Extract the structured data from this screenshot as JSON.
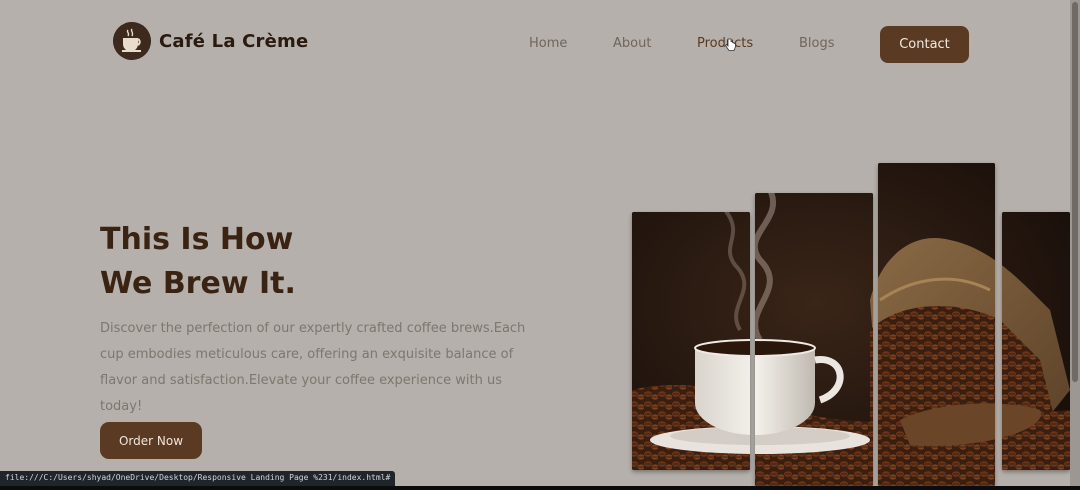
{
  "brand": {
    "name": "Café La Crème",
    "logo_icon": "coffee-cup-logo-icon"
  },
  "nav": {
    "items": [
      {
        "label": "Home"
      },
      {
        "label": "About"
      },
      {
        "label": "Products"
      },
      {
        "label": "Blogs"
      }
    ],
    "contact_label": "Contact"
  },
  "hero": {
    "title_line1": "This Is How",
    "title_line2": "We Brew It.",
    "description": "Discover the perfection of our expertly crafted coffee brews.Each cup embodies meticulous care, offering an exquisite balance of flavor and satisfaction.Elevate your coffee experience with us today!",
    "cta_label": "Order Now",
    "image_subject": "coffee cup with beans and burlap sack"
  },
  "status_bar": {
    "url": "file:///C:/Users/shyad/OneDrive/Desktop/Responsive Landing Page %231/index.html#"
  },
  "colors": {
    "page_bg": "#b5b0ab",
    "brand_brown": "#5a3a22",
    "title_dark": "#3a2312",
    "body_text": "#7e766f"
  }
}
